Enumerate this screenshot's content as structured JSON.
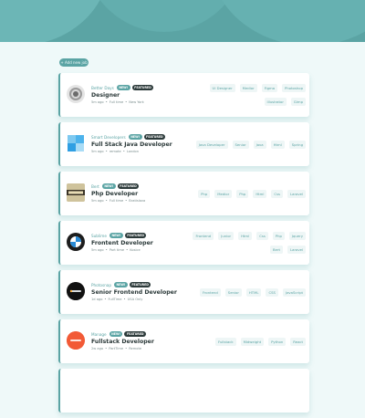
{
  "add_button_label": "+ Add new job",
  "colors": {
    "accent": "#5ba4a4",
    "dark": "#2c3a3a",
    "bg": "#eff9f9",
    "tag_bg": "#eef6f6"
  },
  "jobs": [
    {
      "company": "Better Days",
      "new": "NEW!",
      "featured": "FEATURED",
      "position": "Designer",
      "posted": "5m ago",
      "contract": "Full time",
      "location": "New York",
      "logo_icon": "gray-badge-logo-icon",
      "tags": [
        "UI Designer",
        "Medior",
        "Figma",
        "Photoshop",
        "Illustrator",
        "Gimp"
      ]
    },
    {
      "company": "Smart Developers",
      "new": "NEW!",
      "featured": "FEATURED",
      "position": "Full Stack Java Developer",
      "posted": "5m ago",
      "contract": "remote",
      "location": "London",
      "logo_icon": "blue-windows-logo-icon",
      "tags": [
        "Java Developer",
        "Senior",
        "Java",
        "Html",
        "Spring"
      ]
    },
    {
      "company": "Bert",
      "new": "NEW!",
      "featured": "FEATURED",
      "position": "Php Developer",
      "posted": "5m ago",
      "contract": "Full time",
      "location": "Bratislava",
      "logo_icon": "fendi-logo-icon",
      "tags": [
        "Php",
        "Medior",
        "Php",
        "Html",
        "Css",
        "Laravel"
      ]
    },
    {
      "company": "Sublime",
      "new": "NEW!",
      "featured": "FEATURED",
      "position": "Frontent Developer",
      "posted": "5m ago",
      "contract": "Part time",
      "location": "Kosice",
      "logo_icon": "bmw-logo-icon",
      "tags": [
        "Frontend",
        "Junior",
        "Html",
        "Css",
        "Php",
        "Jquery",
        "Bert",
        "Laravel"
      ]
    },
    {
      "company": "Photosnap",
      "new": "NEW!",
      "featured": "FEATURED",
      "position": "Senior Frontend Developer",
      "posted": "1d ago",
      "contract": "FullTime",
      "location": "USA Only",
      "logo_icon": "photosnap-logo-icon",
      "tags": [
        "Frontend",
        "Senior",
        "HTML",
        "CSS",
        "JavaScript"
      ]
    },
    {
      "company": "Manage",
      "new": "NEW!",
      "featured": "FEATURED",
      "position": "Fullstack Developer",
      "posted": "2w ago",
      "contract": "PartTime",
      "location": "Remote",
      "logo_icon": "manage-logo-icon",
      "tags": [
        "Fullstack",
        "Midweight",
        "Python",
        "React"
      ]
    }
  ]
}
